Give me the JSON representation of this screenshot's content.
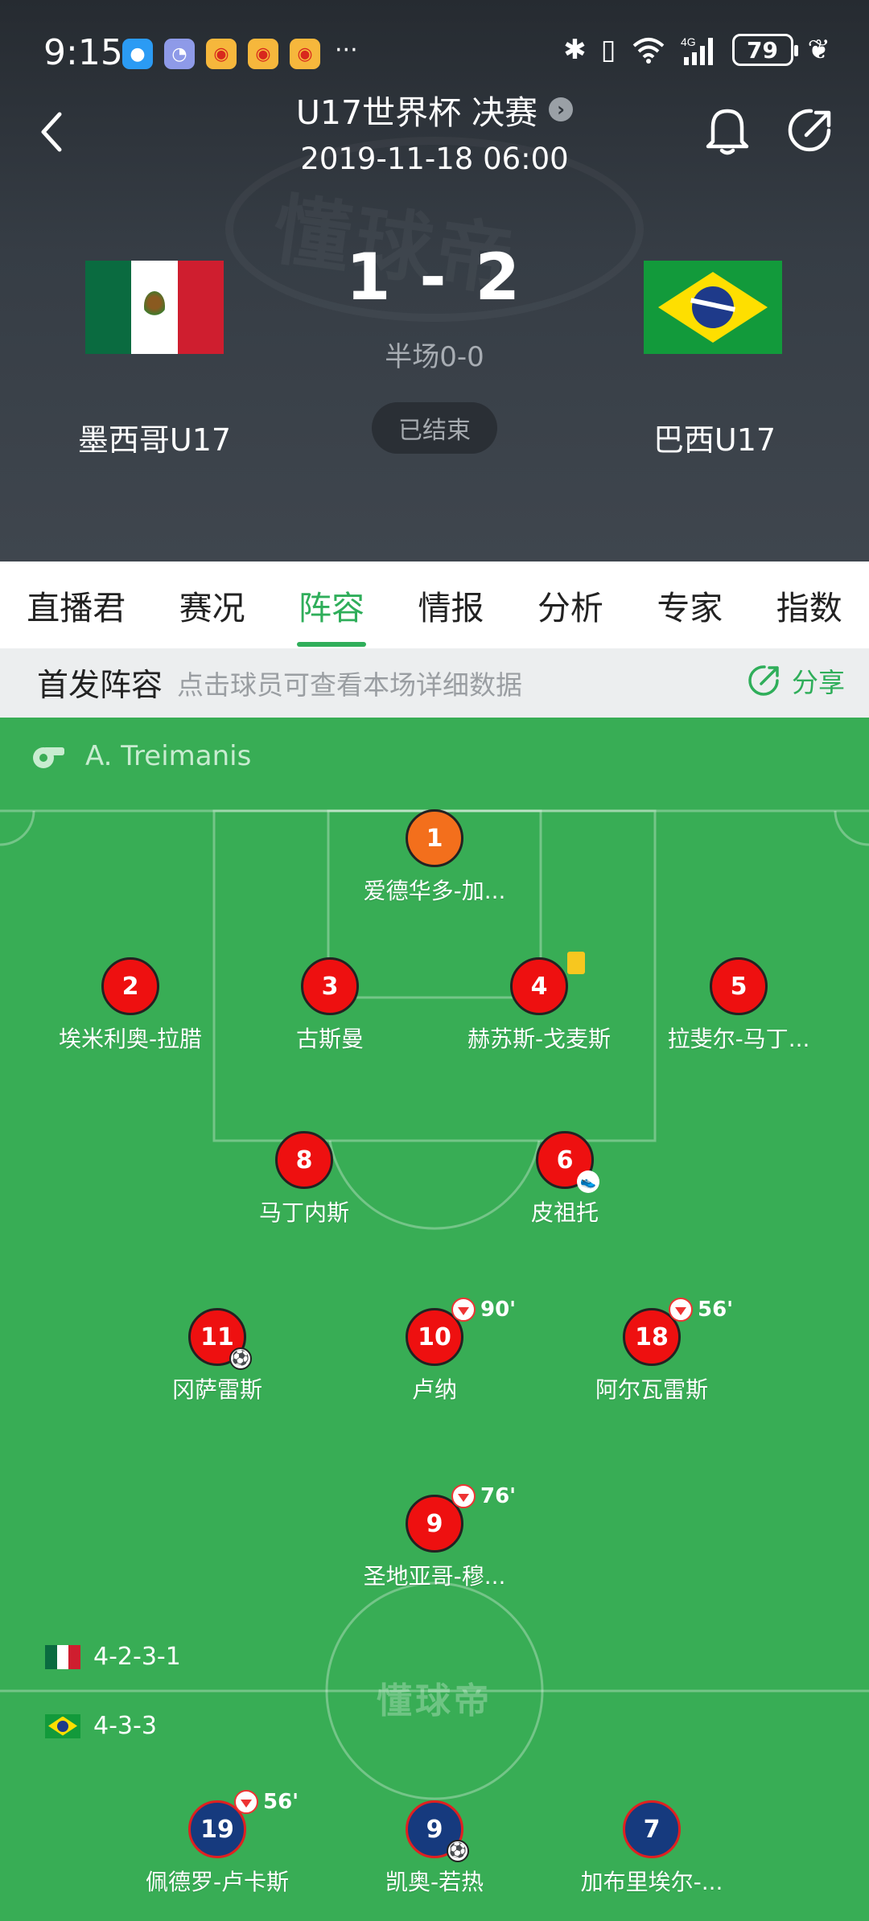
{
  "status_bar": {
    "time": "9:15",
    "battery": "79",
    "network": "4G"
  },
  "header": {
    "title": "U17世界杯 决赛",
    "datetime": "2019-11-18 06:00",
    "score": "1 - 2",
    "halftime": "半场0-0",
    "status": "已结束",
    "watermark": "懂球帝",
    "home_team": {
      "name": "墨西哥U17"
    },
    "away_team": {
      "name": "巴西U17"
    }
  },
  "tabs": [
    {
      "label": "直播君"
    },
    {
      "label": "赛况"
    },
    {
      "label": "阵容",
      "active": true
    },
    {
      "label": "情报"
    },
    {
      "label": "分析"
    },
    {
      "label": "专家"
    },
    {
      "label": "指数"
    }
  ],
  "lineup_bar": {
    "title": "首发阵容",
    "hint": "点击球员可查看本场详细数据",
    "share": "分享"
  },
  "pitch": {
    "referee": "A. Treimanis",
    "center_logo": "懂球帝",
    "home_formation": "4-2-3-1",
    "away_formation": "4-3-3"
  },
  "home_players": [
    {
      "number": "1",
      "name": "爱德华多-加...",
      "role": "gk"
    },
    {
      "number": "2",
      "name": "埃米利奥-拉腊"
    },
    {
      "number": "3",
      "name": "古斯曼"
    },
    {
      "number": "4",
      "name": "赫苏斯-戈麦斯",
      "yellow_card": true
    },
    {
      "number": "5",
      "name": "拉斐尔-马丁..."
    },
    {
      "number": "8",
      "name": "马丁内斯"
    },
    {
      "number": "6",
      "name": "皮祖托",
      "assist": true
    },
    {
      "number": "11",
      "name": "冈萨雷斯",
      "goal": true
    },
    {
      "number": "10",
      "name": "卢纳",
      "sub_minute": "90'"
    },
    {
      "number": "18",
      "name": "阿尔瓦雷斯",
      "sub_minute": "56'"
    },
    {
      "number": "9",
      "name": "圣地亚哥-穆...",
      "sub_minute": "76'"
    }
  ],
  "away_players": [
    {
      "number": "19",
      "name": "佩德罗-卢卡斯",
      "sub_minute": "56'"
    },
    {
      "number": "9",
      "name": "凯奥-若热",
      "goal": true
    },
    {
      "number": "7",
      "name": "加布里埃尔-..."
    }
  ],
  "colors": {
    "pitch": "#38ad55",
    "accent": "#2fae5a",
    "home_shirt": "#ee1010",
    "gk_shirt": "#f36f1c",
    "away_shirt": "#163a7e"
  }
}
